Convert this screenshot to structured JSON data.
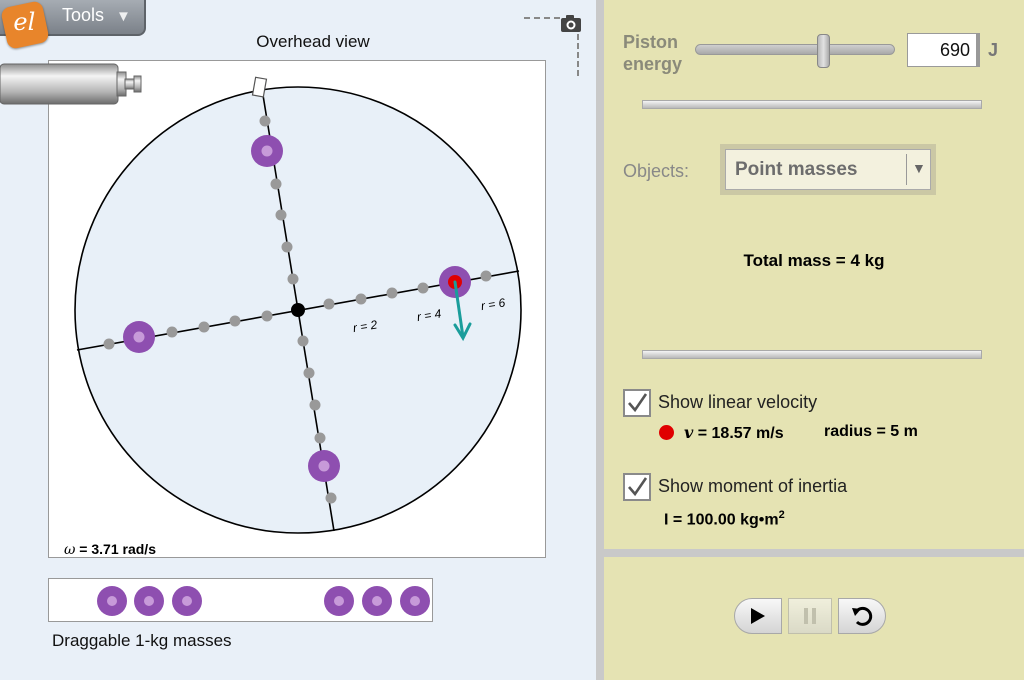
{
  "toolbar": {
    "logo_text": "el",
    "tools_label": "Tools",
    "tools_arrow": "▼"
  },
  "simulation": {
    "overhead_label": "Overhead view",
    "radius_labels": [
      "r = 2",
      "r = 4",
      "r = 6"
    ],
    "omega_symbol": "ω",
    "omega_text": " = 3.71 rad/s",
    "tray_label": "Draggable 1-kg masses",
    "spoke_masses": 4,
    "tray_masses": 6
  },
  "controls": {
    "piston_label_line1": "Piston",
    "piston_label_line2": "energy",
    "piston_energy_value": "690",
    "piston_energy_fraction": 0.65,
    "energy_unit": "J",
    "objects_label": "Objects:",
    "objects_selected": "Point masses",
    "objects_arrow": "▼",
    "total_mass": "Total mass = 4 kg",
    "show_linear_velocity_label": "Show linear velocity",
    "show_linear_velocity_checked": true,
    "velocity_symbol": "v",
    "velocity_text": " = 18.57 m/s",
    "radius_text": "radius = 5 m",
    "show_moment_of_inertia_label": "Show moment of inertia",
    "show_moment_of_inertia_checked": true,
    "inertia_text": "I = 100.00 kg•m",
    "inertia_exponent": "2"
  },
  "colors": {
    "mass_purple": "#8e4fb0",
    "mass_center": "#c79ad9",
    "velocity_arrow": "#1a9d9b",
    "velocity_dot": "#e00000",
    "panel_bg": "#e5e3b3",
    "sim_bg": "#e9f0f8"
  }
}
